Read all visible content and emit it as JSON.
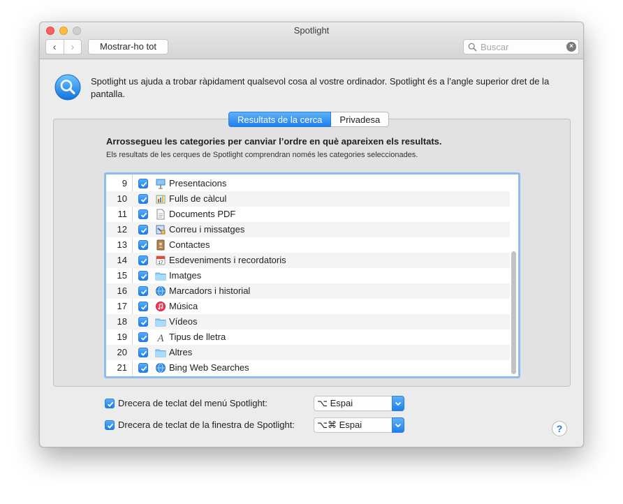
{
  "window": {
    "title": "Spotlight",
    "show_all_label": "Mostrar-ho tot",
    "search_placeholder": "Buscar",
    "nav_back_glyph": "‹",
    "nav_forward_glyph": "›",
    "search_icon": "search-icon",
    "clear_icon": "clear-icon"
  },
  "intro": {
    "text": "Spotlight us ajuda a trobar ràpidament qualsevol cosa al vostre ordinador. Spotlight és a l’angle superior dret de la pantalla.",
    "icon": "spotlight-icon"
  },
  "tabs": [
    {
      "label": "Resultats de la cerca",
      "active": true
    },
    {
      "label": "Privadesa",
      "active": false
    }
  ],
  "results": {
    "heading": "Arrossegueu les categories per canviar l’ordre en què apareixen els resultats.",
    "subheading": "Els resultats de les cerques de Spotlight comprendran només les categories seleccionades.",
    "categories": [
      {
        "num": "9",
        "label": "Presentacions",
        "checked": true,
        "icon": "presentation-icon"
      },
      {
        "num": "10",
        "label": "Fulls de càlcul",
        "checked": true,
        "icon": "spreadsheet-icon"
      },
      {
        "num": "11",
        "label": "Documents PDF",
        "checked": true,
        "icon": "pdf-document-icon"
      },
      {
        "num": "12",
        "label": "Correu i missatges",
        "checked": true,
        "icon": "mail-icon"
      },
      {
        "num": "13",
        "label": "Contactes",
        "checked": true,
        "icon": "contacts-icon"
      },
      {
        "num": "14",
        "label": "Esdeveniments i recordatoris",
        "checked": true,
        "icon": "calendar-icon"
      },
      {
        "num": "15",
        "label": "Imatges",
        "checked": true,
        "icon": "folder-icon"
      },
      {
        "num": "16",
        "label": "Marcadors i historial",
        "checked": true,
        "icon": "globe-icon"
      },
      {
        "num": "17",
        "label": "Música",
        "checked": true,
        "icon": "music-icon"
      },
      {
        "num": "18",
        "label": "Vídeos",
        "checked": true,
        "icon": "folder-icon"
      },
      {
        "num": "19",
        "label": "Tipus de lletra",
        "checked": true,
        "icon": "font-icon"
      },
      {
        "num": "20",
        "label": "Altres",
        "checked": true,
        "icon": "folder-icon"
      },
      {
        "num": "21",
        "label": "Bing Web Searches",
        "checked": true,
        "icon": "globe-icon"
      }
    ]
  },
  "shortcuts": {
    "menu_label": "Drecera de teclat del menú Spotlight:",
    "menu_value": "⌥ Espai",
    "window_label": "Drecera de teclat de la finestra de Spotlight:",
    "window_value": "⌥⌘ Espai"
  },
  "help_label": "?",
  "colors": {
    "accent": "#1e80ee",
    "selection_border": "#8fbcef",
    "close": "#fc605c",
    "minimize": "#fdbc40"
  }
}
